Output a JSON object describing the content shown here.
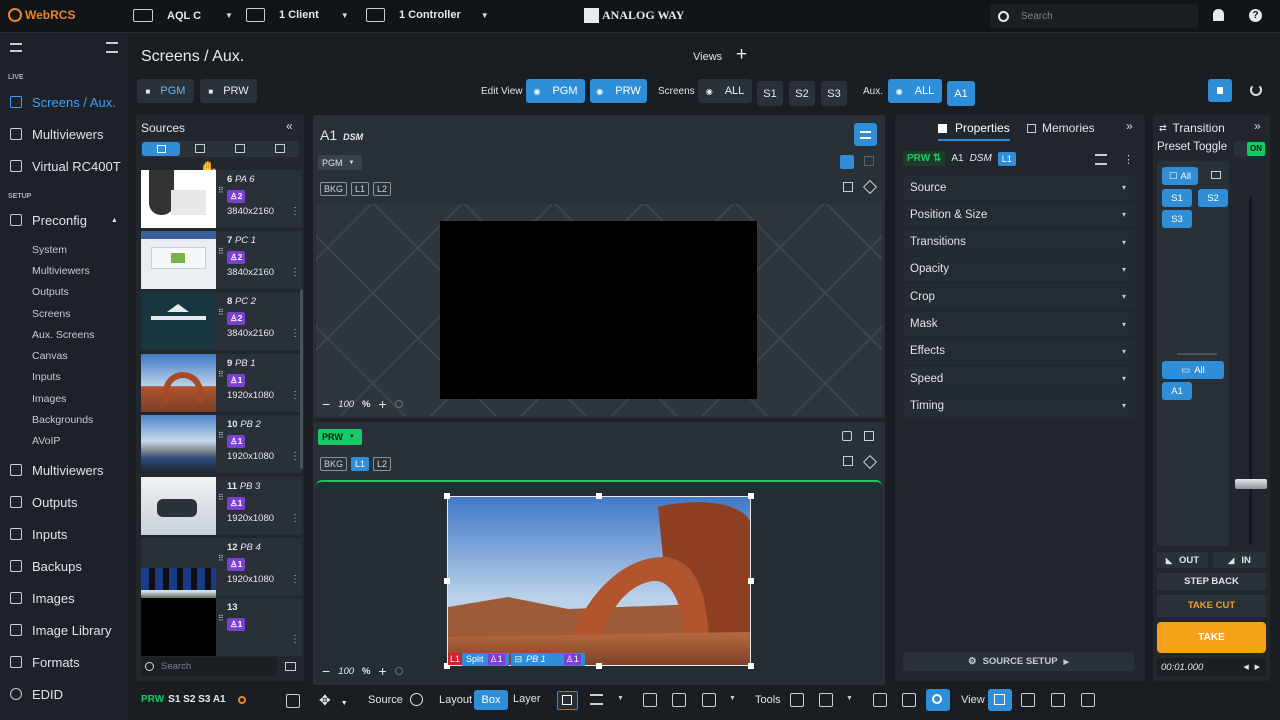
{
  "header": {
    "app": "WebRCS",
    "device": "AQL C",
    "clients": "1 Client",
    "controllers": "1 Controller",
    "brand": "ANALOG WAY",
    "search_placeholder": "Search"
  },
  "page": {
    "title": "Screens / Aux.",
    "views_label": "Views",
    "pgm": "PGM",
    "prw": "PRW",
    "edit_view_label": "Edit View",
    "screens_label": "Screens",
    "all": "ALL",
    "s1": "S1",
    "s2": "S2",
    "s3": "S3",
    "aux_label": "Aux.",
    "a1": "A1"
  },
  "sidebar": {
    "live_label": "LIVE",
    "live_items": [
      "Screens / Aux.",
      "Multiviewers",
      "Virtual RC400T"
    ],
    "setup_label": "SETUP",
    "preconfig": "Preconfig",
    "preconfig_items": [
      "System",
      "Multiviewers",
      "Outputs",
      "Screens",
      "Aux. Screens",
      "Canvas",
      "Inputs",
      "Images",
      "Backgrounds",
      "AVoIP"
    ],
    "bottom_items": [
      "Multiviewers",
      "Outputs",
      "Inputs",
      "Backups",
      "Images",
      "Image Library",
      "Formats",
      "EDID"
    ]
  },
  "sources": {
    "title": "Sources",
    "search_placeholder": "Search",
    "items": [
      {
        "num": "6",
        "name": "PA 6",
        "badge": "♙2",
        "res": "3840x2160"
      },
      {
        "num": "7",
        "name": "PC 1",
        "badge": "♙2",
        "res": "3840x2160"
      },
      {
        "num": "8",
        "name": "PC 2",
        "badge": "♙2",
        "res": "3840x2160"
      },
      {
        "num": "9",
        "name": "PB 1",
        "badge": "♙1",
        "res": "1920x1080"
      },
      {
        "num": "10",
        "name": "PB 2",
        "badge": "♙1",
        "res": "1920x1080"
      },
      {
        "num": "11",
        "name": "PB 3",
        "badge": "♙1",
        "res": "1920x1080"
      },
      {
        "num": "12",
        "name": "PB 4",
        "badge": "♙1",
        "res": "1920x1080"
      },
      {
        "num": "13",
        "name": "",
        "badge": "♙1",
        "res": ""
      }
    ]
  },
  "canvas": {
    "screen": "A1",
    "format": "DSM",
    "pgm_dropdown": "PGM",
    "prw_dropdown": "PRW",
    "bkg": "BKG",
    "l1": "L1",
    "l2": "L2",
    "zoom_top": "100",
    "zoom_bottom": "100",
    "percent": "%",
    "layer_red": "L1",
    "layer_split": "Split",
    "layer_badge": "♙1",
    "layer_source": "PB 1",
    "layer_badge2": "♙1"
  },
  "properties": {
    "tab_properties": "Properties",
    "tab_memories": "Memories",
    "prw": "PRW",
    "screen": "A1",
    "format": "DSM",
    "layer": "L1",
    "rows": [
      "Source",
      "Position & Size",
      "Transitions",
      "Opacity",
      "Crop",
      "Mask",
      "Effects",
      "Speed",
      "Timing"
    ],
    "source_setup": "SOURCE SETUP"
  },
  "transition": {
    "title": "Transition",
    "preset_toggle": "Preset Toggle",
    "on": "ON",
    "all": "All",
    "s1": "S1",
    "s2": "S2",
    "s3": "S3",
    "all2": "All",
    "a1": "A1",
    "out": "OUT",
    "in": "IN",
    "step_back": "STEP BACK",
    "take_cut": "TAKE CUT",
    "take": "TAKE",
    "time": "00:01.000"
  },
  "bottom": {
    "prw_label": "PRW",
    "screens": "S1 S2 S3 A1",
    "source": "Source",
    "layout": "Layout",
    "box": "Box",
    "layer": "Layer",
    "tools": "Tools",
    "view": "View"
  }
}
